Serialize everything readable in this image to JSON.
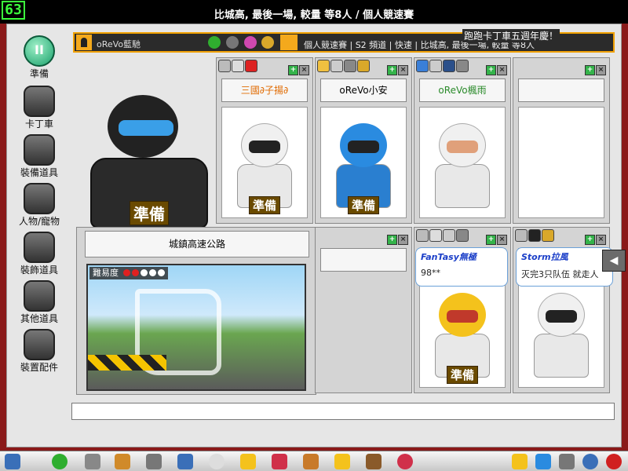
{
  "hud": {
    "fps": "63"
  },
  "room_title": "比城高, 最後一場, 較量  等8人  /  個人競速賽",
  "menu": [
    {
      "label": "準備",
      "icon": "pause-ready-icon"
    },
    {
      "label": "卡丁車",
      "icon": "kart-icon"
    },
    {
      "label": "裝備道具",
      "icon": "equipment-icon"
    },
    {
      "label": "人物/寵物",
      "icon": "character-pet-icon"
    },
    {
      "label": "裝飾道具",
      "icon": "decoration-icon"
    },
    {
      "label": "其他道具",
      "icon": "other-items-icon"
    },
    {
      "label": "裝置配件",
      "icon": "parts-icon"
    }
  ],
  "info_bar": {
    "username": "oReVo藍馳",
    "room_detail": "個人競速賽  |  S2 頻道  |  快速  |  比城高, 最後一場, 較量  等8人",
    "announcement": "跑跑卡丁車五週年慶！"
  },
  "slots": [
    {
      "name": "三國∂子揚∂",
      "name_color": "#e06a00",
      "status": "準備",
      "helmet_color": "#f0f0f0",
      "skin": "#ffffff"
    },
    {
      "name": "oReVo小安",
      "name_color": "#222222",
      "status": "準備",
      "helmet_color": "#2a8be0",
      "skin": "#1f6fc0"
    },
    {
      "name": "oReVo楓雨",
      "name_color": "#2a8a2a",
      "status": "",
      "helmet_color": "#f0f0f0",
      "skin": "#ffffff"
    },
    {
      "name": "",
      "name_color": "#222222",
      "status": "",
      "helmet_color": "",
      "skin": ""
    },
    {
      "name": "",
      "name_color": "#222222",
      "status": "",
      "helmet_color": "",
      "skin": ""
    },
    {
      "name": "",
      "name_color": "#222222",
      "status": "準備",
      "helmet_color": "#f4c21c",
      "skin": "#f4c21c"
    },
    {
      "name": "",
      "name_color": "#222222",
      "status": "",
      "helmet_color": "#f0f0f0",
      "skin": "#ffffff"
    }
  ],
  "host": {
    "status": "準備"
  },
  "track": {
    "name": "城鎮高速公路",
    "difficulty_label": "難易度",
    "difficulty_level": 2,
    "difficulty_max": 5
  },
  "bubbles": [
    {
      "who": "FanTasy無極",
      "msg": "98**"
    },
    {
      "who": "Storm拉風",
      "msg": "灭完3只队伍 就走人"
    }
  ],
  "chat": {
    "placeholder": ""
  }
}
